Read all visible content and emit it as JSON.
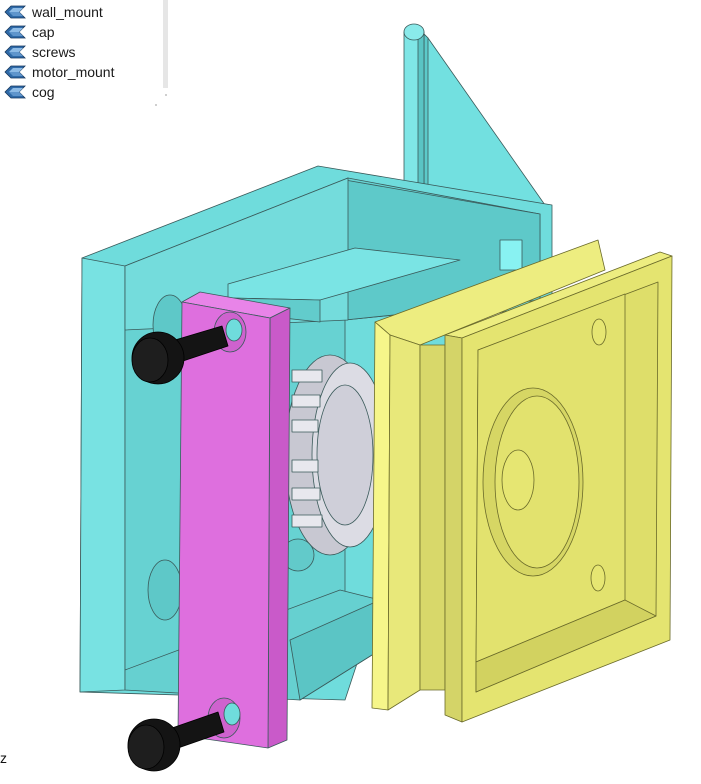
{
  "tree": {
    "items": [
      {
        "label": "wall_mount",
        "icon": "part-body-icon"
      },
      {
        "label": "cap",
        "icon": "part-body-icon"
      },
      {
        "label": "screws",
        "icon": "part-body-icon"
      },
      {
        "label": "motor_mount",
        "icon": "part-body-icon"
      },
      {
        "label": "cog",
        "icon": "part-body-icon"
      }
    ]
  },
  "viewport": {
    "axis_label": "z",
    "colors": {
      "wall_mount": "#6fdcdc",
      "cap": "#de6fde",
      "motor_mount": "#e4e470",
      "screws": "#141414",
      "cog": "#d3d3dd"
    }
  }
}
